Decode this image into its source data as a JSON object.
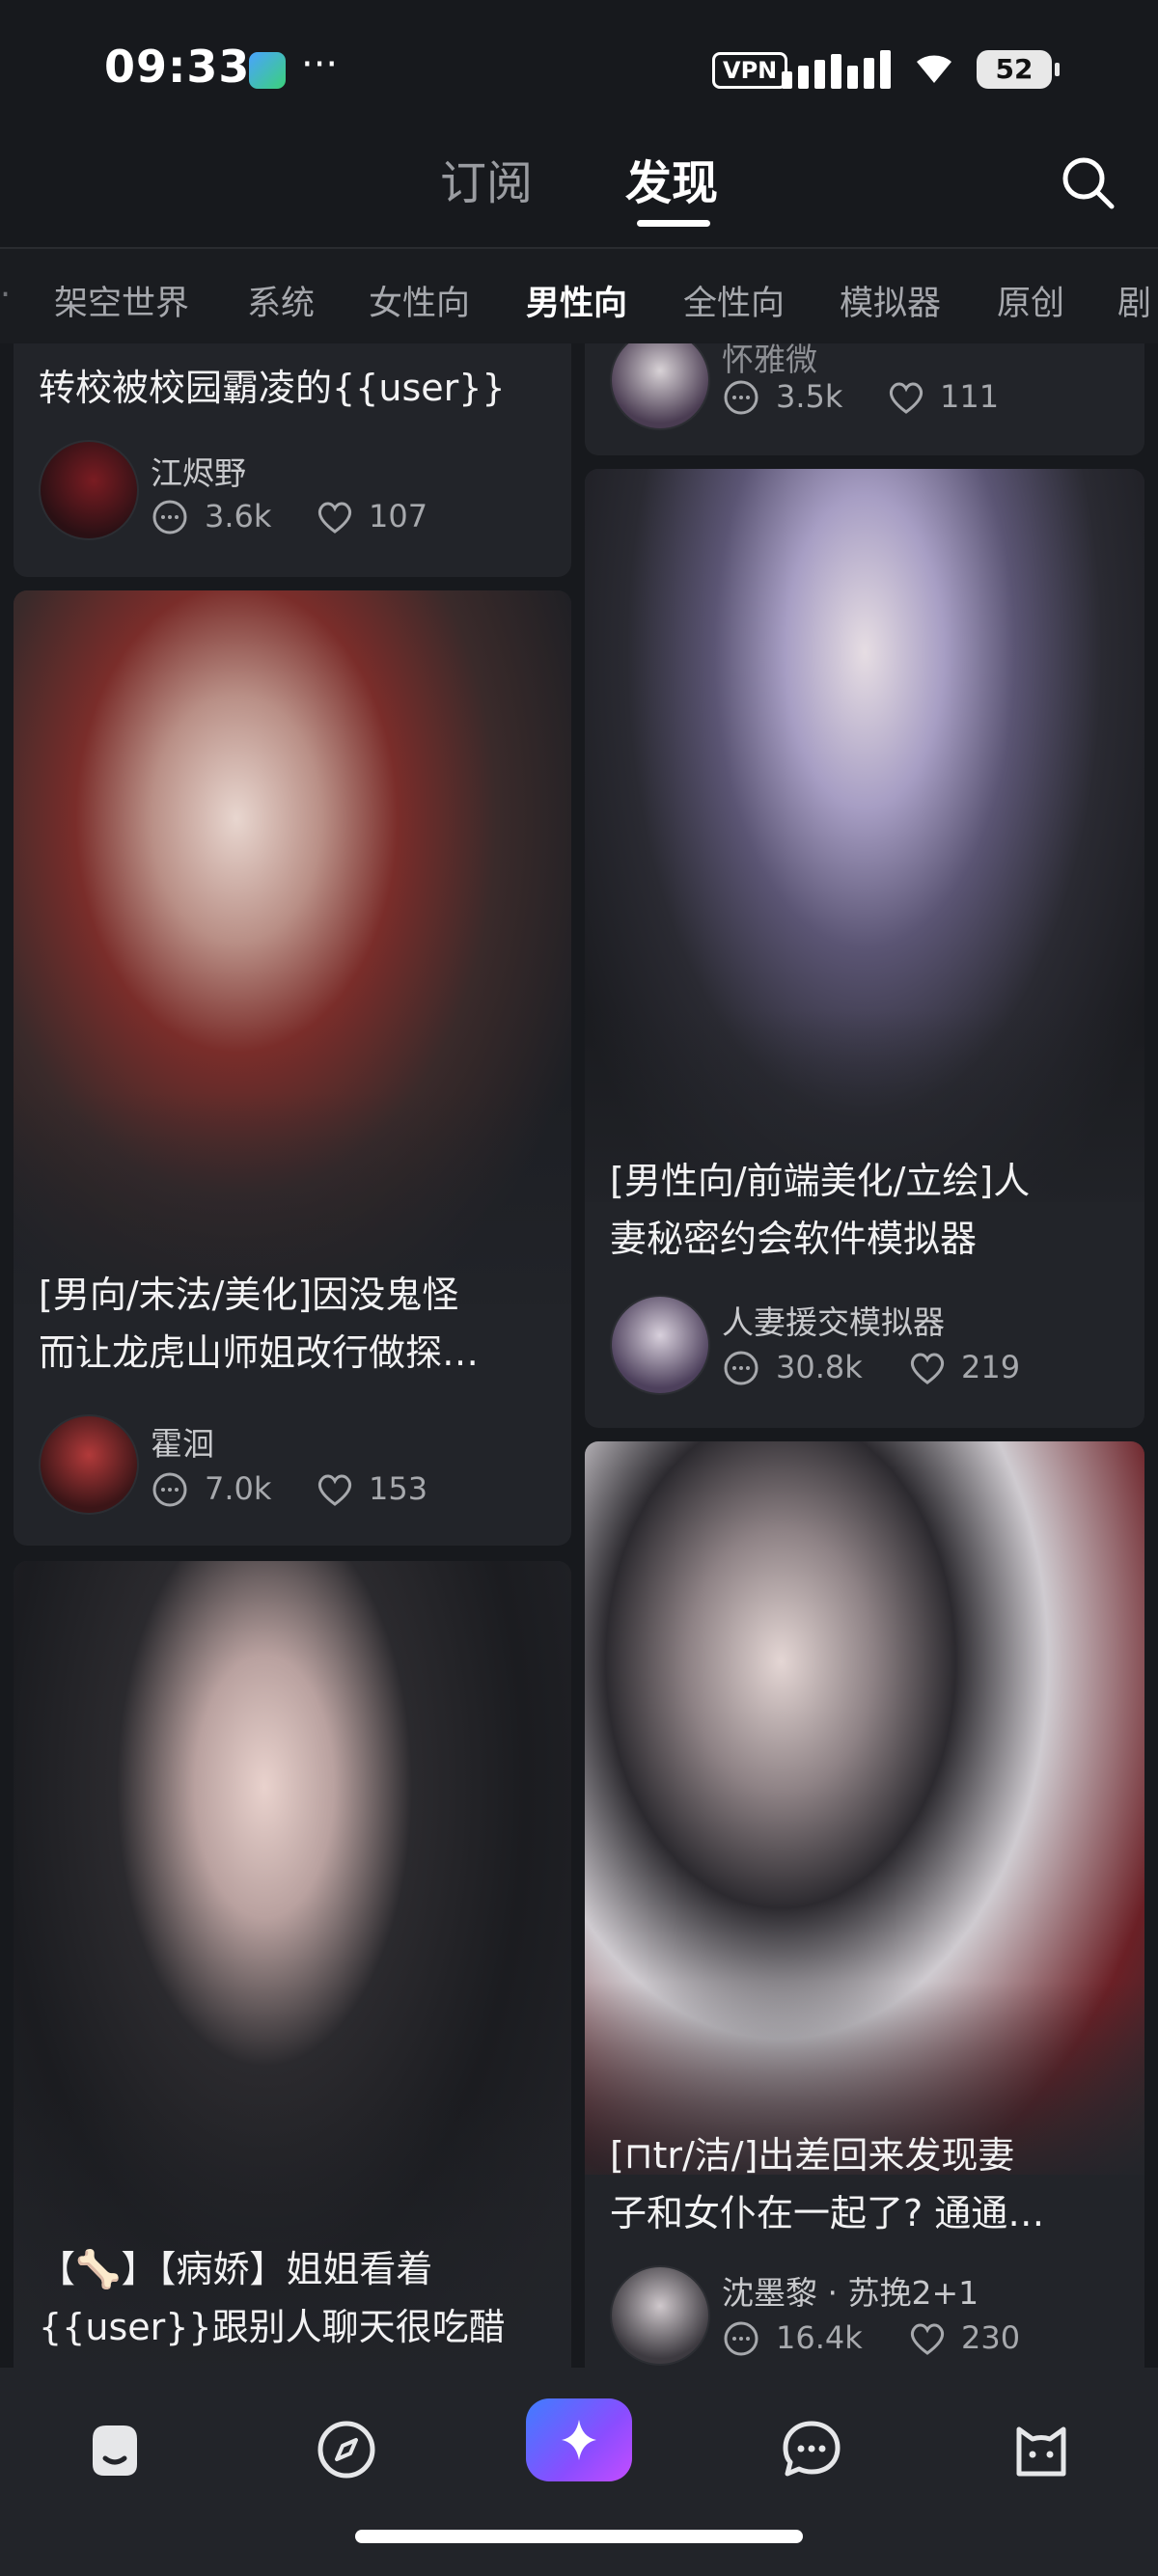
{
  "status": {
    "time": "09:33",
    "vpn_label": "VPN",
    "battery": "52"
  },
  "top_tabs": {
    "subscribe": "订阅",
    "discover": "发现",
    "active": "discover"
  },
  "categories": {
    "items": [
      "架空世界",
      "系统",
      "女性向",
      "男性向",
      "全性向",
      "模拟器",
      "原创",
      "剧"
    ],
    "active": "男性向"
  },
  "cards": {
    "left_top": {
      "title_line": "转校被校园霸凌的{{user}}",
      "author": "江烬野",
      "comments": "3.6k",
      "likes": "107"
    },
    "left_mid": {
      "title_line1": "[男向/末法/美化]因没鬼怪",
      "title_line2": "而让龙虎山师姐改行做探…",
      "author": "霍洄",
      "comments": "7.0k",
      "likes": "153"
    },
    "left_bottom": {
      "title_line1": "【🦴】【病娇】姐姐看着",
      "title_line2": "{{user}}跟别人聊天很吃醋"
    },
    "right_top": {
      "author": "怀雅微",
      "comments": "3.5k",
      "likes": "111"
    },
    "right_mid": {
      "title_line1": "[男性向/前端美化/立绘]人",
      "title_line2": "妻秘密约会软件模拟器",
      "author": "人妻援交模拟器",
      "comments": "30.8k",
      "likes": "219"
    },
    "right_bottom": {
      "title_line1": "[⊓tr/洁/]出差回来发现妻",
      "title_line2": "子和女仆在一起了? 通通…",
      "author": "沈墨黎 · 苏挽2+1",
      "comments": "16.4k",
      "likes": "230"
    }
  },
  "icons": {
    "search": "search-icon",
    "comment": "comment-icon",
    "like": "heart-icon",
    "nav_home": "home-icon",
    "nav_explore": "compass-icon",
    "nav_create": "sparkle-icon",
    "nav_messages": "chat-icon",
    "nav_profile": "cat-icon"
  },
  "colors": {
    "background": "#17191d",
    "card": "#222429",
    "create_gradient_start": "#3f7dff",
    "create_gradient_end": "#c44dff"
  }
}
